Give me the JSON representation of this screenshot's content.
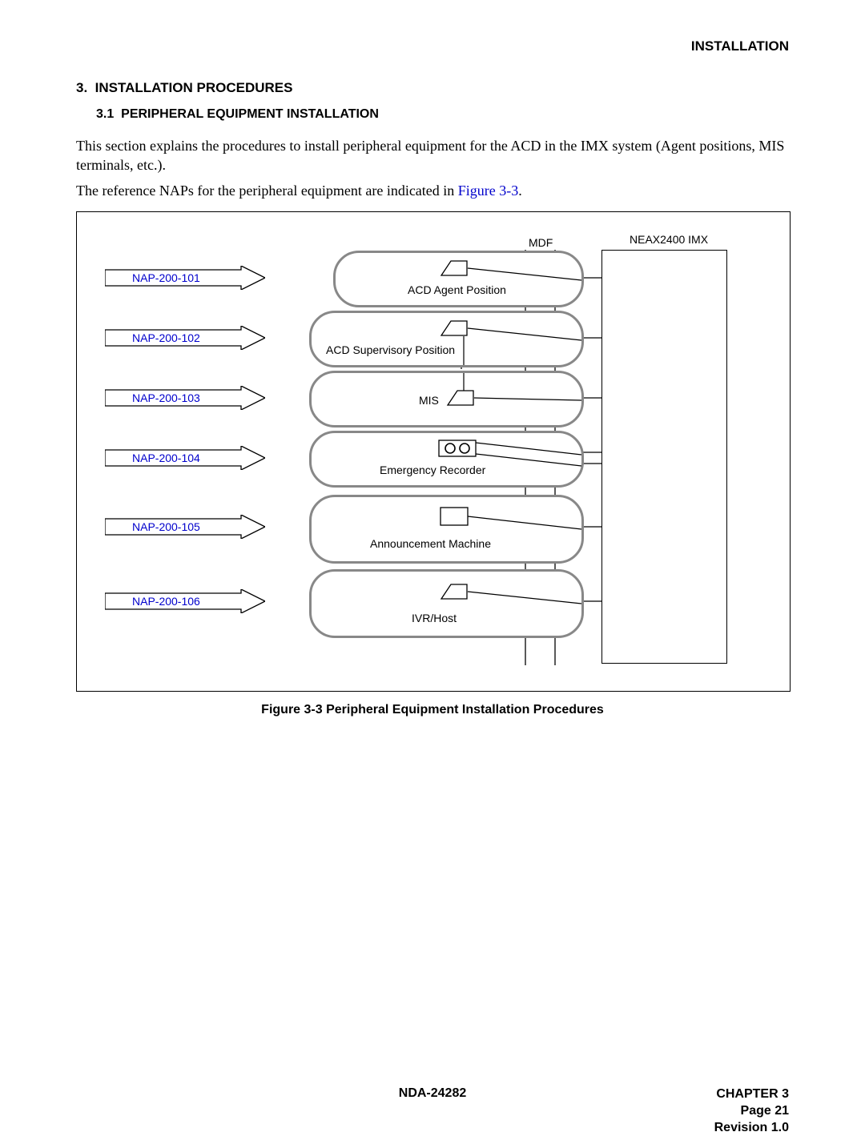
{
  "header": {
    "running_title": "INSTALLATION"
  },
  "section": {
    "number": "3.",
    "title": "INSTALLATION PROCEDURES",
    "subsection_number": "3.1",
    "subsection_title": "PERIPHERAL EQUIPMENT INSTALLATION"
  },
  "body": {
    "para1": "This section explains the procedures to install peripheral equipment for the ACD in the IMX system (Agent positions, MIS terminals, etc.).",
    "para2_pre": "The reference NAPs for the peripheral equipment are indicated in ",
    "para2_link": "Figure 3-3",
    "para2_post": "."
  },
  "diagram": {
    "mdf_label": "MDF",
    "system_label": "NEAX2400 IMX",
    "naps": [
      {
        "code": "NAP-200-101",
        "equipment": "ACD Agent Position"
      },
      {
        "code": "NAP-200-102",
        "equipment": "ACD Supervisory Position"
      },
      {
        "code": "NAP-200-103",
        "equipment": "MIS"
      },
      {
        "code": "NAP-200-104",
        "equipment": "Emergency Recorder"
      },
      {
        "code": "NAP-200-105",
        "equipment": "Announcement Machine"
      },
      {
        "code": "NAP-200-106",
        "equipment": "IVR/Host"
      }
    ],
    "caption": "Figure 3-3   Peripheral Equipment Installation Procedures"
  },
  "footer": {
    "doc_number": "NDA-24282",
    "chapter": "CHAPTER 3",
    "page": "Page 21",
    "revision": "Revision 1.0"
  }
}
